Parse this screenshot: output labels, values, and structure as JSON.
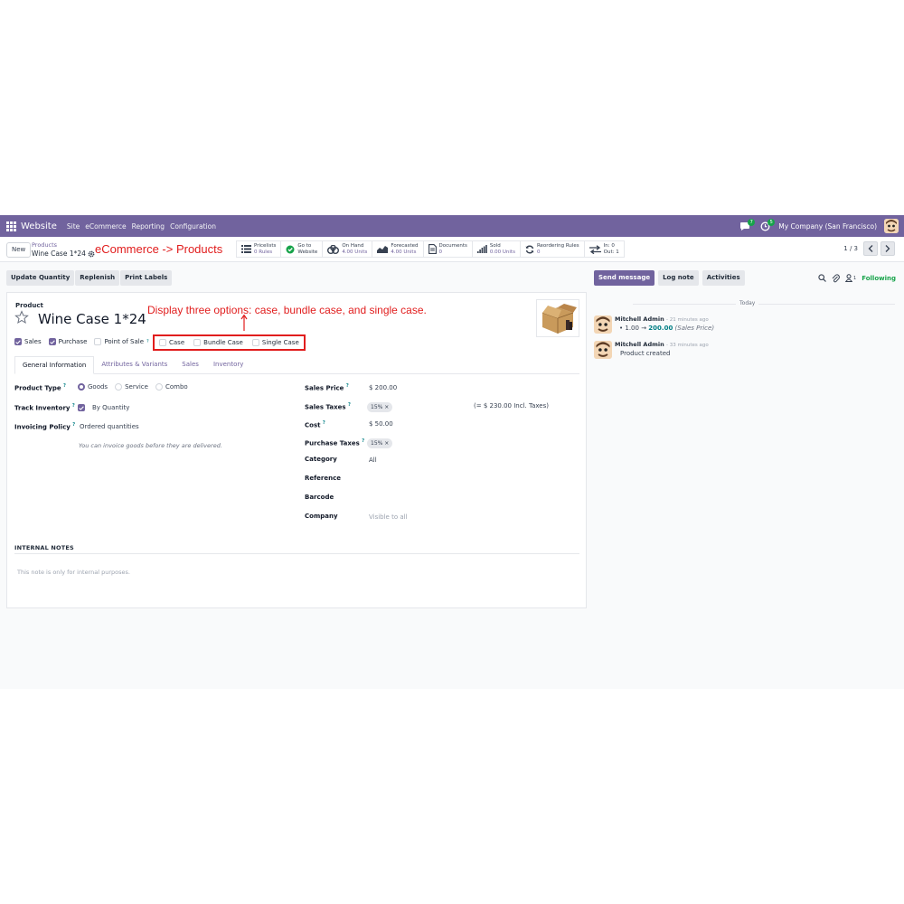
{
  "navbar": {
    "brand": "Website",
    "menus": [
      "Site",
      "eCommerce",
      "Reporting",
      "Configuration"
    ],
    "messages_badge": "7",
    "activities_badge": "5",
    "company": "My Company (San Francisco)"
  },
  "control": {
    "new_label": "New",
    "breadcrumb_parent": "Products",
    "breadcrumb_current": "Wine Case 1*24",
    "annotation_path": "eCommerce -> Products",
    "stats": [
      {
        "label": "Pricelists",
        "value": "0 Rules",
        "icon": "list-icon"
      },
      {
        "label": "Go to",
        "value": "Website",
        "icon": "globe-icon"
      },
      {
        "label": "On Hand",
        "value": "4.00 Units",
        "icon": "cubes-icon"
      },
      {
        "label": "Forecasted",
        "value": "4.00 Units",
        "icon": "area-chart-icon"
      },
      {
        "label": "Documents",
        "value": "0",
        "icon": "document-icon"
      },
      {
        "label": "Sold",
        "value": "0.00 Units",
        "icon": "bar-chart-icon"
      },
      {
        "label": "Reordering Rules",
        "value": "0",
        "icon": "refresh-icon"
      },
      {
        "label": "In: 0",
        "value": "Out: 1",
        "icon": "exchange-icon"
      }
    ],
    "pager": "1 / 3"
  },
  "actions": [
    "Update Quantity",
    "Replenish",
    "Print Labels"
  ],
  "form": {
    "product_label": "Product",
    "product_name": "Wine Case 1*24",
    "annotation_display": "Display three options: case, bundle case, and single case.",
    "checks": [
      {
        "label": "Sales",
        "checked": true
      },
      {
        "label": "Purchase",
        "checked": true
      },
      {
        "label": "Point of Sale",
        "checked": false
      }
    ],
    "case_options": [
      "Case",
      "Bundle Case",
      "Single Case"
    ],
    "tabs": [
      "General Information",
      "Attributes & Variants",
      "Sales",
      "Inventory"
    ],
    "active_tab": "General Information",
    "left": {
      "product_type_label": "Product Type",
      "product_types": [
        "Goods",
        "Service",
        "Combo"
      ],
      "selected_type": "Goods",
      "track_inventory_label": "Track Inventory",
      "track_inventory_value": "By Quantity",
      "invoicing_policy_label": "Invoicing Policy",
      "invoicing_policy_value": "Ordered quantities",
      "invoicing_hint": "You can invoice goods before they are delivered."
    },
    "right": {
      "sales_price_label": "Sales Price",
      "sales_price_value": "$ 200.00",
      "sales_taxes_label": "Sales Taxes",
      "sales_tax_tag": "15% ×",
      "incl_taxes": "(= $ 230.00 Incl. Taxes)",
      "cost_label": "Cost",
      "cost_value": "$ 50.00",
      "purchase_taxes_label": "Purchase Taxes",
      "purchase_tax_tag": "15% ×",
      "category_label": "Category",
      "category_value": "All",
      "reference_label": "Reference",
      "barcode_label": "Barcode",
      "company_label": "Company",
      "company_placeholder": "Visible to all"
    },
    "notes_title": "INTERNAL NOTES",
    "notes_placeholder": "This note is only for internal purposes."
  },
  "chatter": {
    "send_message": "Send message",
    "log_note": "Log note",
    "activities": "Activities",
    "followers_count": "1",
    "following": "Following",
    "today": "Today",
    "messages": [
      {
        "author": "Mitchell Admin",
        "time": "- 21 minutes ago",
        "old_value": "1.00",
        "arrow": "→",
        "new_value": "200.00",
        "field": "(Sales Price)"
      },
      {
        "author": "Mitchell Admin",
        "time": "- 33 minutes ago",
        "body": "Product created"
      }
    ]
  },
  "colors": {
    "brand": "#71639e",
    "annotation": "#e11d1d",
    "success": "#17a34a",
    "link": "#017e84"
  }
}
